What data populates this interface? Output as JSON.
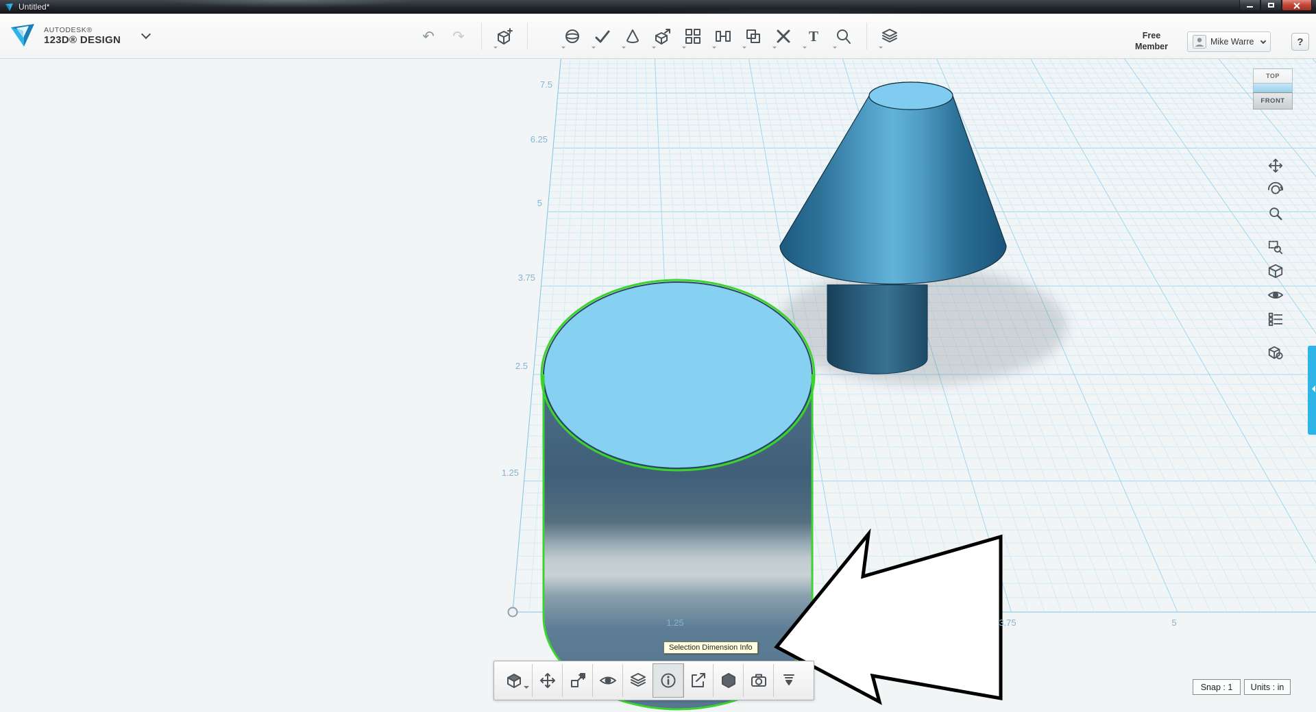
{
  "window": {
    "title": "Untitled*"
  },
  "header": {
    "brand_line1": "AUTODESK®",
    "brand_line2": "123D® DESIGN",
    "free_line1": "Free",
    "free_line2": "Member",
    "user_name": "Mike Warre ...",
    "help_label": "?"
  },
  "icons": {
    "undo": "↶",
    "redo": "↷",
    "text_tool": "T"
  },
  "main_toolbar_icons": [
    "undo",
    "redo",
    "primitives",
    "construct",
    "sketch",
    "cone-primitive",
    "create",
    "pattern",
    "snap",
    "combine",
    "delete",
    "text",
    "tweak",
    "group"
  ],
  "viewcube": {
    "top": "TOP",
    "front": "FRONT"
  },
  "nav_icons": [
    "pan",
    "orbit",
    "zoom",
    "zoom-window",
    "view-cube",
    "show-hide",
    "display-settings",
    "material"
  ],
  "grid": {
    "left_labels": [
      "7.5",
      "6.25",
      "5",
      "3.75",
      "2.5",
      "1.25"
    ],
    "bottom_labels": [
      "1.25",
      "3.75",
      "5"
    ]
  },
  "selection_toolbar_icons": [
    "solid-cube",
    "move",
    "scale",
    "visibility",
    "layers",
    "selection-dimension-info",
    "export",
    "material",
    "snapshot",
    "collapse"
  ],
  "tooltip": {
    "text": "Selection Dimension Info"
  },
  "statusbar": {
    "snap": "Snap : 1",
    "units": "Units : in"
  },
  "colors": {
    "accent": "#2fb4e8",
    "selection_outline": "#3bd42e",
    "grid_major": "#a0d6ee",
    "grid_minor": "#d2ecf8",
    "solid_top": "#86d0f2",
    "solid_side": "#3f5f79"
  }
}
